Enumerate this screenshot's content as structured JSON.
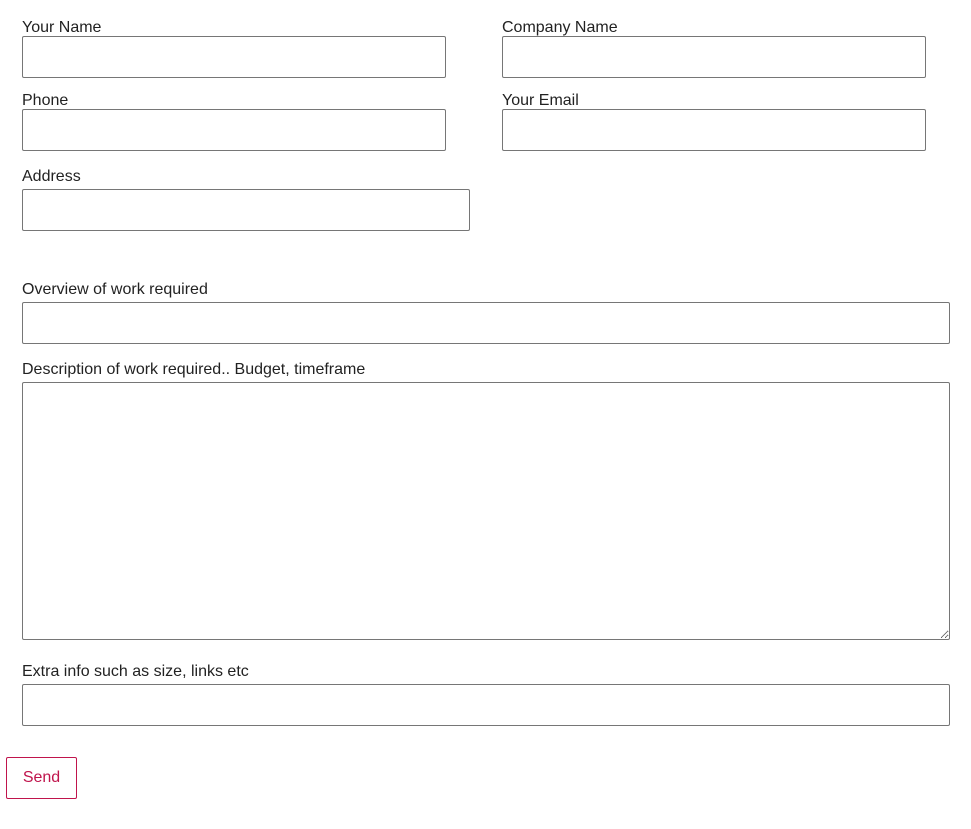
{
  "form": {
    "your_name": {
      "label": "Your Name",
      "value": "",
      "placeholder": ""
    },
    "company_name": {
      "label": "Company Name",
      "value": "",
      "placeholder": ""
    },
    "phone": {
      "label": "Phone",
      "value": "",
      "placeholder": ""
    },
    "your_email": {
      "label": "Your Email",
      "value": "",
      "placeholder": ""
    },
    "address": {
      "label": "Address",
      "value": "",
      "placeholder": ""
    },
    "overview": {
      "label": "Overview of work required",
      "value": "",
      "placeholder": ""
    },
    "description": {
      "label": "Description of work required.. Budget, timeframe",
      "value": "",
      "placeholder": ""
    },
    "extra_info": {
      "label": "Extra info such as size, links etc",
      "value": "",
      "placeholder": ""
    },
    "send_label": "Send"
  },
  "colors": {
    "accent": "#c0144c",
    "text": "#222222",
    "border": "#767676",
    "background": "#ffffff"
  }
}
